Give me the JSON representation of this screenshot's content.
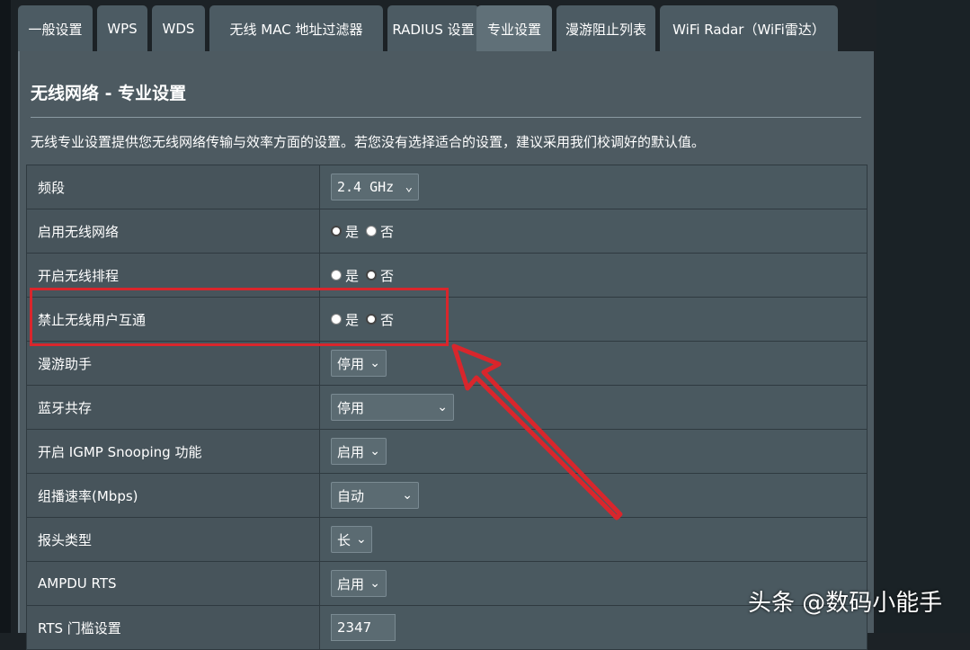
{
  "tabs": [
    {
      "label": "一般设置",
      "active": false
    },
    {
      "label": "WPS",
      "active": false
    },
    {
      "label": "WDS",
      "active": false
    },
    {
      "label": "无线 MAC 地址过滤器",
      "active": false
    },
    {
      "label": "RADIUS 设置",
      "active": false
    },
    {
      "label": "专业设置",
      "active": true
    },
    {
      "label": "漫游阻止列表",
      "active": false
    },
    {
      "label": "WiFi Radar（WiFi雷达）",
      "active": false
    }
  ],
  "page": {
    "title": "无线网络 - 专业设置",
    "description": "无线专业设置提供您无线网络传输与效率方面的设置。若您没有选择适合的设置，建议采用我们校调好的默认值。"
  },
  "radio": {
    "yes": "是",
    "no": "否"
  },
  "settings": [
    {
      "label": "频段",
      "type": "select",
      "value": "2.4 GHz"
    },
    {
      "label": "启用无线网络",
      "type": "radio",
      "selected": "yes"
    },
    {
      "label": "开启无线排程",
      "type": "radio",
      "selected": "no"
    },
    {
      "label": "禁止无线用户互通",
      "type": "radio",
      "selected": "no"
    },
    {
      "label": "漫游助手",
      "type": "select",
      "value": "停用"
    },
    {
      "label": "蓝牙共存",
      "type": "select",
      "value": "停用"
    },
    {
      "label": "开启 IGMP Snooping 功能",
      "type": "select",
      "value": "启用"
    },
    {
      "label": "组播速率(Mbps)",
      "type": "select",
      "value": "自动"
    },
    {
      "label": "报头类型",
      "type": "select",
      "value": "长"
    },
    {
      "label": "AMPDU RTS",
      "type": "select",
      "value": "启用"
    },
    {
      "label": "RTS 门槛设置",
      "type": "text",
      "value": "2347"
    }
  ],
  "annotation": {
    "color": "#d9262c"
  },
  "watermark": "头条 @数码小能手"
}
